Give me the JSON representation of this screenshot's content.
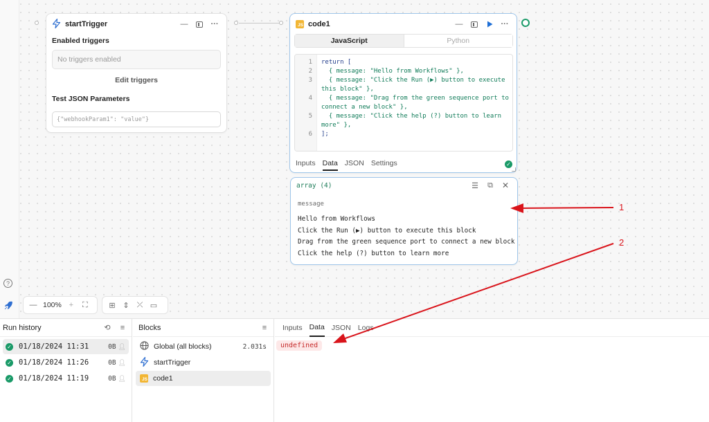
{
  "start_trigger": {
    "title": "startTrigger",
    "enabled_label": "Enabled triggers",
    "no_triggers": "No triggers enabled",
    "edit_button": "Edit triggers",
    "test_label": "Test JSON Parameters",
    "test_placeholder": "{\"webhookParam1\": \"value\"}"
  },
  "code_block": {
    "title": "code1",
    "icon_text": "JS",
    "lang_js": "JavaScript",
    "lang_py": "Python",
    "line_numbers": [
      "1",
      "2",
      "3",
      "4",
      "5",
      "6"
    ],
    "code_lines": [
      "return [",
      "  { message: \"Hello from Workflows\" },",
      "  { message: \"Click the Run (▶) button to execute",
      "this block\" },",
      "  { message: \"Drag from the green sequence port to",
      "connect a new block\" },",
      "  { message: \"Click the help (?) button to learn",
      "more\" },",
      "];"
    ],
    "tabs": [
      "Inputs",
      "Data",
      "JSON",
      "Settings"
    ]
  },
  "result": {
    "title": "array (4)",
    "column": "message",
    "rows": [
      "Hello from Workflows",
      "Click the Run (▶) button to execute this block",
      "Drag from the green sequence port to connect a new block",
      "Click the help (?) button to learn more"
    ]
  },
  "annotations": {
    "arrow1_label": "1",
    "arrow2_label": "2",
    "color": "#d9141b"
  },
  "toolbar": {
    "zoom": "100%"
  },
  "run_history": {
    "title": "Run history",
    "runs": [
      {
        "time": "01/18/2024 11:31",
        "size": "0B"
      },
      {
        "time": "01/18/2024 11:26",
        "size": "0B"
      },
      {
        "time": "01/18/2024 11:19",
        "size": "0B"
      }
    ]
  },
  "blocks_pane": {
    "title": "Blocks",
    "items": [
      {
        "label": "Global (all blocks)",
        "duration": "2.031s"
      },
      {
        "label": "startTrigger"
      },
      {
        "label": "code1",
        "icon_text": "JS"
      }
    ]
  },
  "output_pane": {
    "tabs": [
      "Inputs",
      "Data",
      "JSON",
      "Logs"
    ],
    "value": "undefined"
  },
  "colors": {
    "accent_green": "#1a9a68",
    "selected_border": "#9ec5ea",
    "run_blue": "#1f6fd6",
    "js_badge": "#f2b634"
  }
}
